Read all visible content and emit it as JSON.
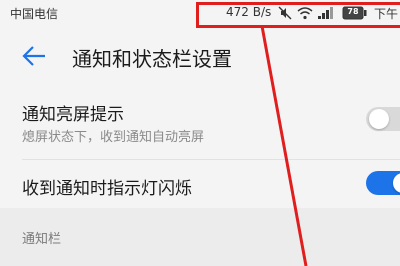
{
  "status_bar": {
    "carrier": "中国电信",
    "net_speed": "472 B/s",
    "battery": "78",
    "clock_partial": "下午"
  },
  "header": {
    "title": "通知和状态栏设置",
    "back_icon": "arrow-left-icon"
  },
  "settings": [
    {
      "title": "通知亮屏提示",
      "subtitle": "熄屏状态下，收到通知自动亮屏",
      "enabled": false
    },
    {
      "title": "收到通知时指示灯闪烁",
      "enabled": true
    }
  ],
  "section": {
    "header": "通知栏"
  },
  "colors": {
    "accent": "#1c74e8",
    "annotation": "#e01e1e",
    "toggle_off": "#d9d9d9",
    "background": "#f4f4f4"
  },
  "icons": [
    "mute-icon",
    "wifi-icon",
    "signal-icon",
    "battery-icon"
  ]
}
